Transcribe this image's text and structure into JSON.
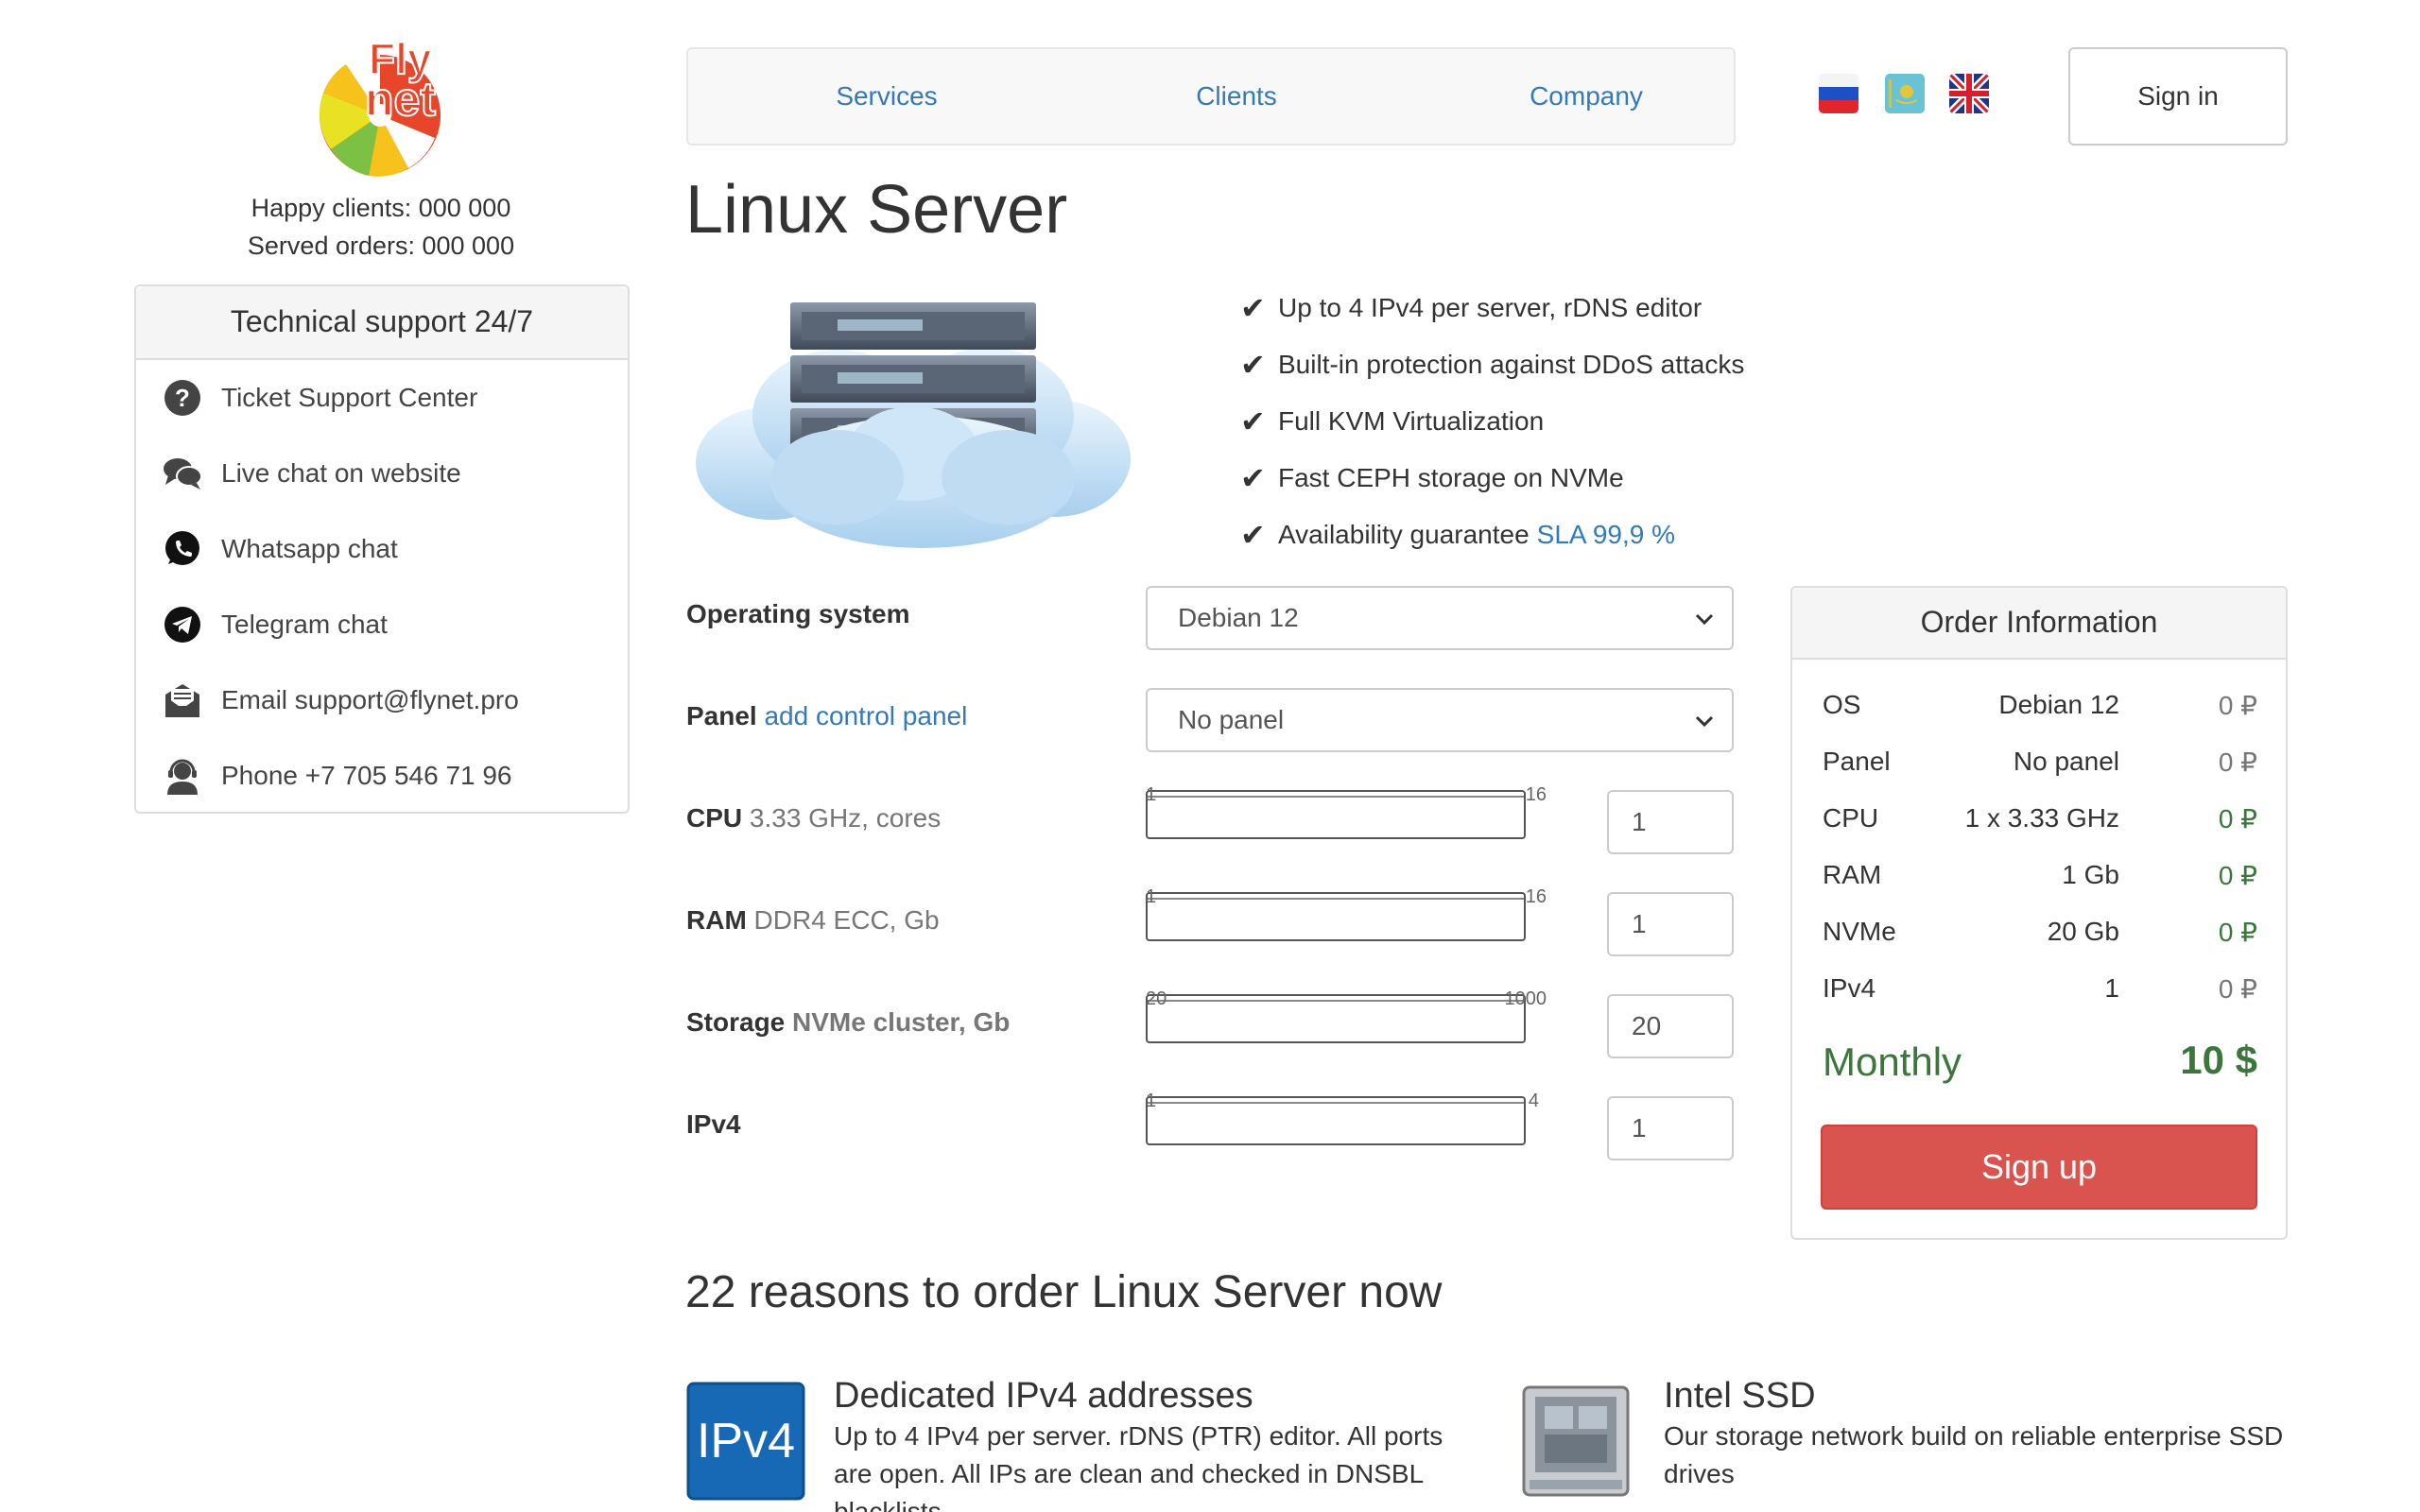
{
  "brand": {
    "logo_line1": "Fly",
    "logo_line2": "net"
  },
  "stats": {
    "happy_clients": "Happy clients: 000 000",
    "served_orders": "Served orders: 000 000"
  },
  "support": {
    "title": "Technical support 24/7",
    "items": [
      {
        "label": "Ticket Support Center",
        "icon": "question-icon"
      },
      {
        "label": "Live chat on website",
        "icon": "chat-bubbles-icon"
      },
      {
        "label": "Whatsapp chat",
        "icon": "whatsapp-icon"
      },
      {
        "label": "Telegram chat",
        "icon": "telegram-icon"
      },
      {
        "label": "Email support@flynet.pro",
        "icon": "email-icon"
      },
      {
        "label": "Phone +7 705 546 71 96",
        "icon": "headset-icon"
      }
    ]
  },
  "nav": {
    "services": "Services",
    "clients": "Clients",
    "company": "Company",
    "sign_in": "Sign in"
  },
  "languages": [
    "ru-flag-icon",
    "kz-flag-icon",
    "uk-flag-icon"
  ],
  "page": {
    "title": "Linux Server"
  },
  "features": [
    "Up to 4 IPv4 per server, rDNS editor",
    "Built-in protection against DDoS attacks",
    "Full KVM Virtualization",
    "Fast CEPH storage on NVMe",
    "Availability guarantee"
  ],
  "feature_link": "SLA 99,9 %",
  "check_glyph": "✔",
  "form": {
    "os": {
      "label": "Operating system",
      "value": "Debian 12"
    },
    "panel": {
      "label": "Panel",
      "link": "add control panel",
      "value": "No panel"
    },
    "cpu": {
      "label": "CPU",
      "sub": "3.33 GHz, cores",
      "min": "1",
      "max": "16",
      "value": "1"
    },
    "ram": {
      "label": "RAM",
      "sub": "DDR4 ECC, Gb",
      "min": "1",
      "max": "16",
      "value": "1"
    },
    "storage": {
      "label": "Storage",
      "sub": "NVMe cluster, Gb",
      "min": "20",
      "max": "1000",
      "value": "20"
    },
    "ipv4": {
      "label": "IPv4",
      "min": "1",
      "max": "4",
      "value": "1"
    }
  },
  "order": {
    "title": "Order Information",
    "rows": [
      {
        "key": "OS",
        "value": "Debian 12",
        "price": "0 ₽"
      },
      {
        "key": "Panel",
        "value": "No panel",
        "price": "0 ₽"
      },
      {
        "key": "CPU",
        "value": "1 x 3.33 GHz",
        "price": "0 ₽"
      },
      {
        "key": "RAM",
        "value": "1 Gb",
        "price": "0 ₽"
      },
      {
        "key": "NVMe",
        "value": "20 Gb",
        "price": "0 ₽"
      },
      {
        "key": "IPv4",
        "value": "1",
        "price": "0 ₽"
      }
    ],
    "monthly_label": "Monthly",
    "total": "10 $",
    "signup": "Sign up"
  },
  "reasons": {
    "title": "22 reasons to order Linux Server now",
    "items": [
      {
        "title": "Dedicated IPv4 addresses",
        "icon_text": "IPv4",
        "text_lines": [
          "Up to 4 IPv4 per server. rDNS (PTR) editor. All ports",
          "are open. All IPs are clean and checked in DNSBL",
          "blacklists"
        ]
      },
      {
        "title": "Intel SSD",
        "text_lines": [
          "Our storage network build on reliable enterprise SSD",
          "drives"
        ]
      }
    ]
  },
  "colors": {
    "link": "#337ab7",
    "green": "#3c763d",
    "danger": "#d9534f"
  }
}
